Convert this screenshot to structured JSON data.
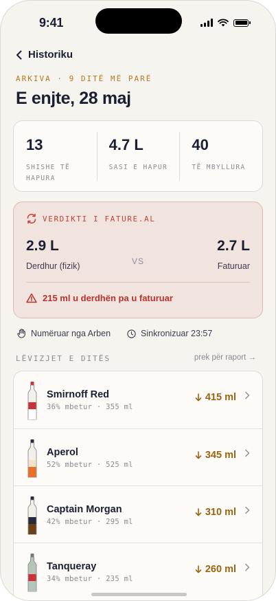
{
  "status": {
    "time": "9:41"
  },
  "nav": {
    "back_label": "Historiku"
  },
  "header": {
    "overline": "ARKIVA · 9 DITË MË PARË",
    "title": "E enjte, 28 maj"
  },
  "stats": [
    {
      "value": "13",
      "caption": "SHISHE TË HAPURA"
    },
    {
      "value": "4.7 L",
      "caption": "SASI E HAPUR"
    },
    {
      "value": "40",
      "caption": "TË MBYLLURA"
    }
  ],
  "verdict": {
    "title": "VERDIKTI I FATURE.AL",
    "poured_value": "2.9 L",
    "poured_label": "Derdhur (fizik)",
    "vs_label": "VS",
    "billed_value": "2.7 L",
    "billed_label": "Faturuar",
    "warning": "215 ml u derdhën pa u faturuar",
    "accent_color": "#c2413a"
  },
  "meta": {
    "counted_by": "Numëruar nga Arben",
    "synced": "Sinkronizuar 23:57"
  },
  "movements": {
    "title": "LËVIZJET E DITËS",
    "link": "prek për raport →",
    "items": [
      {
        "name": "Smirnoff Red",
        "detail": "36% mbetur · 355 ml",
        "amount": "415 ml",
        "level": 0.36,
        "glass": "#f3efe9",
        "label": "#c8333a",
        "liquid": "#ffffff",
        "cap": "#c8333a"
      },
      {
        "name": "Aperol",
        "detail": "52% mbetur · 525 ml",
        "amount": "345 ml",
        "level": 0.52,
        "glass": "#f3efe9",
        "label": "#f0e3c8",
        "liquid": "#e8702a",
        "cap": "#2b2b3a"
      },
      {
        "name": "Captain Morgan",
        "detail": "42% mbetur · 295 ml",
        "amount": "310 ml",
        "level": 0.42,
        "glass": "#f3efe9",
        "label": "#262a3a",
        "liquid": "#6b3f17",
        "cap": "#262a3a"
      },
      {
        "name": "Tanqueray",
        "detail": "34% mbetur · 235 ml",
        "amount": "260 ml",
        "level": 0.34,
        "glass": "#b7c4b8",
        "label": "#c8333a",
        "liquid": "#b7c4b8",
        "cap": "#6e7f72"
      }
    ]
  }
}
